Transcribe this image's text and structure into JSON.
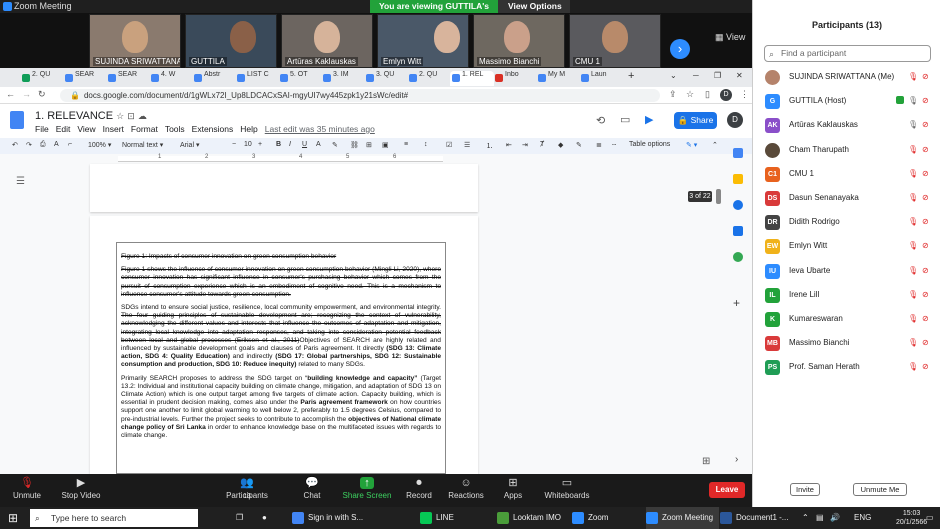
{
  "zoom": {
    "window_title": "Zoom Meeting",
    "viewing_banner": "You are viewing GUTTILA's screen",
    "view_options": "View Options",
    "view_label": "View",
    "gallery": [
      {
        "name": "SUJINDA SRIWATTANA"
      },
      {
        "name": "GUTTILA"
      },
      {
        "name": "Artūras Kaklauskas"
      },
      {
        "name": "Emlyn Witt"
      },
      {
        "name": "Massimo Bianchi"
      },
      {
        "name": "CMU 1"
      }
    ],
    "controls": {
      "unmute": "Unmute",
      "stop_video": "Stop Video",
      "participants": "Participants",
      "participants_count": "13",
      "chat": "Chat",
      "share_screen": "Share Screen",
      "record": "Record",
      "reactions": "Reactions",
      "apps": "Apps",
      "whiteboards": "Whiteboards",
      "leave": "Leave"
    }
  },
  "browser": {
    "tabs": [
      "2. QU",
      "SEAR",
      "SEAR",
      "4. W",
      "Abstr",
      "LIST C",
      "5. OT",
      "3. IM",
      "3. QU",
      "2. QU",
      "1. REL",
      "Inbo",
      "My M",
      "Laun"
    ],
    "active_tab_index": 10,
    "url": "docs.google.com/document/d/1gWLx72I_Up8LDCACxSAI-mgyUI7wy445zpk1y21sWc/edit#",
    "profile": "D"
  },
  "docs": {
    "doc_title": "1. RELEVANCE",
    "menus": [
      "File",
      "Edit",
      "View",
      "Insert",
      "Format",
      "Tools",
      "Extensions",
      "Help"
    ],
    "last_edit": "Last edit was 35 minutes ago",
    "share": "Share",
    "toolbar": {
      "zoom": "100%",
      "style": "Normal text",
      "font": "Arial",
      "size": "10",
      "table_options": "Table options"
    },
    "ruler_ticks": [
      "1",
      "2",
      "3",
      "4",
      "5",
      "6"
    ],
    "page_indicator": "3 of 22",
    "content": {
      "figure_heading": "Figure 1: Impacts of consumer innovation on green consumption behavior",
      "figure_caption": "Figure 1 shows the influence of consumer innovation on green consumption behavior (Mingli Li, 2020), where consumer innovation has significant influence in consumer's purchasing behavior which comes from the pursuit of consumption experience which is an embodiment of cognitive need. This is a mechanism to influence consumer's attitude towards green consumption.",
      "p1_intro": "SDGs intend to ensure social justice, resilience, local community empowerment, and environmental integrity.",
      "p1_strike": "The four guiding principles of sustainable development are; recognizing the context of vulnerability, acknowledging the different values and interests that influence the outcomes of adaptation and mitigation, integrating local knowledge into adaptation responses, and taking into consideration potential feedback between local and global processes (Eriksen et al., 2011)",
      "p1_a": "Objectives of SEARCH are highly related and influenced by sustainable development goals and clauses of Paris agreement. It directly ",
      "p1_b": "(SDG 13: Climate action, SDG 4: Quality Education)",
      "p1_c": " and indirectly ",
      "p1_d": "(SDG 17: Global partnerships, SDG 12: Sustainable consumption and production, SDG 10: Reduce inequity)",
      "p1_e": " related to many SDGs.",
      "p2_a": "Primarily SEARCH proposes to address the SDG target on “",
      "p2_b": "building knowledge and capacity”",
      "p2_c": " (Target 13.2: Individual and institutional capacity building on climate change, mitigation, and adaptation of SDG 13 on Climate Action) which is one output target among five targets of climate action. Capacity building, which is essential in prudent decision making, comes also under the ",
      "p2_d": "Paris agreement framework",
      "p2_e": " on how countries support one another to limit global warming to well below 2, preferably to 1.5 degrees Celsius, compared to pre-industrial levels. Further the project seeks to contribute to accomplish the ",
      "p2_f": "objectives of National climate change policy of Sri Lanka",
      "p2_g": " in order to enhance knowledge base on the multifaceted issues with regards to climate change."
    }
  },
  "participants_panel": {
    "title": "Participants (13)",
    "search_placeholder": "Find a participant",
    "list": [
      {
        "name": "SUJINDA SRIWATTANA (Me)",
        "initials": "",
        "color": "#b5836b",
        "mic": "muted",
        "cam": "off"
      },
      {
        "name": "GUTTILA (Host)",
        "initials": "G",
        "color": "#2d8cff",
        "mic": "on",
        "cam": "off"
      },
      {
        "name": "Artūras Kaklauskas",
        "initials": "AK",
        "color": "#8a4fc9",
        "mic": "on",
        "cam": "off"
      },
      {
        "name": "Cham Tharupath",
        "initials": "",
        "color": "#5a4a3a",
        "mic": "muted",
        "cam": "off"
      },
      {
        "name": "CMU 1",
        "initials": "C1",
        "color": "#e8621e",
        "mic": "muted",
        "cam": "off"
      },
      {
        "name": "Dasun Senanayaka",
        "initials": "DS",
        "color": "#d93a3a",
        "mic": "muted",
        "cam": "off"
      },
      {
        "name": "Didith Rodrigo",
        "initials": "DR",
        "color": "#444444",
        "mic": "muted",
        "cam": "off"
      },
      {
        "name": "Emlyn Witt",
        "initials": "EW",
        "color": "#f0b21a",
        "mic": "muted",
        "cam": "off"
      },
      {
        "name": "Ieva Ubarte",
        "initials": "IU",
        "color": "#2d8cff",
        "mic": "muted",
        "cam": "off"
      },
      {
        "name": "Irene Lill",
        "initials": "IL",
        "color": "#22a23a",
        "mic": "muted",
        "cam": "off"
      },
      {
        "name": "Kumareswaran",
        "initials": "K",
        "color": "#22a23a",
        "mic": "muted",
        "cam": "off"
      },
      {
        "name": "Massimo Bianchi",
        "initials": "MB",
        "color": "#d93a3a",
        "mic": "muted",
        "cam": "off"
      },
      {
        "name": "Prof. Saman Herath",
        "initials": "PS",
        "color": "#1f9d55",
        "mic": "muted",
        "cam": "off"
      }
    ],
    "invite": "Invite",
    "unmute_me": "Unmute Me"
  },
  "taskbar": {
    "search_placeholder": "Type here to search",
    "apps": [
      {
        "label": "Sign in with S...",
        "color": "#4285f4"
      },
      {
        "label": "LINE",
        "color": "#06c755"
      },
      {
        "label": "Looktam IMO",
        "color": "#4a9d3a"
      },
      {
        "label": "Zoom",
        "color": "#2d8cff"
      },
      {
        "label": "Zoom Meeting",
        "color": "#2d8cff"
      },
      {
        "label": "Document1 -...",
        "color": "#2b579a"
      }
    ],
    "language": "ENG",
    "time": "15:03",
    "date": "20/1/2566"
  }
}
